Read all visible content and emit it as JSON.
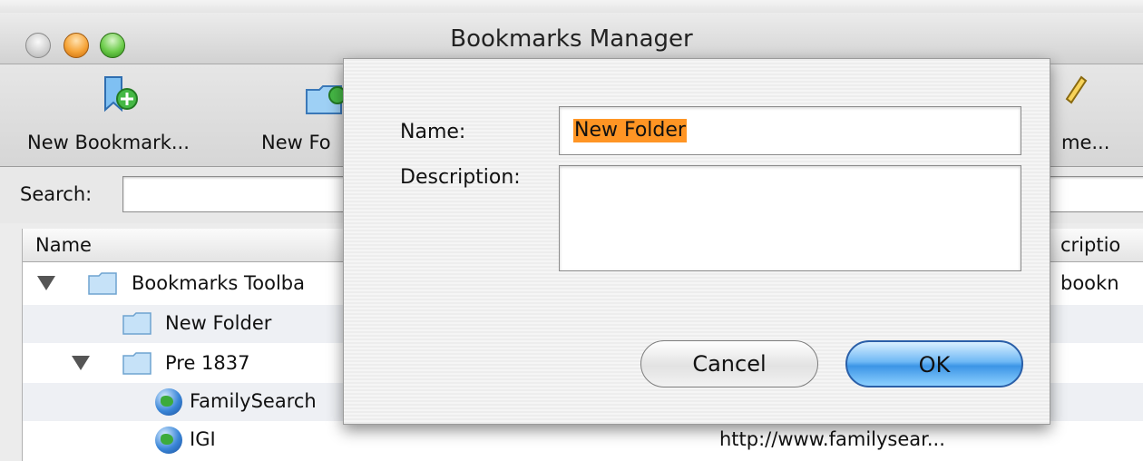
{
  "window": {
    "title": "Bookmarks Manager"
  },
  "toolbar": {
    "new_bookmark_label": "New Bookmark...",
    "new_folder_label": "New Fo",
    "rename_label": "me...",
    "new_bookmark_icon": "bookmark-add-icon",
    "new_folder_icon": "folder-add-icon",
    "rename_icon": "pencil-icon"
  },
  "search": {
    "label": "Search:",
    "value": ""
  },
  "table": {
    "columns": {
      "name": "Name",
      "description": "criptio"
    },
    "rows": [
      {
        "name": "Bookmarks Toolba",
        "description": "bookn",
        "icon": "folder-icon",
        "expanded": true
      },
      {
        "name": "New Folder",
        "description": "",
        "icon": "folder-icon"
      },
      {
        "name": "Pre 1837",
        "description": "",
        "icon": "folder-icon",
        "expanded": true
      },
      {
        "name": "FamilySearch",
        "description": "",
        "icon": "globe-icon"
      },
      {
        "name": "IGI",
        "description": "",
        "location": "http://www.familysear...",
        "icon": "globe-icon"
      }
    ]
  },
  "dialog": {
    "name_label": "Name:",
    "name_value": "New Folder",
    "description_label": "Description:",
    "description_value": "",
    "cancel_label": "Cancel",
    "ok_label": "OK"
  },
  "colors": {
    "selection": "#ff9524",
    "default_button": "#3c95e6",
    "row_alt": "#eef0f4"
  }
}
